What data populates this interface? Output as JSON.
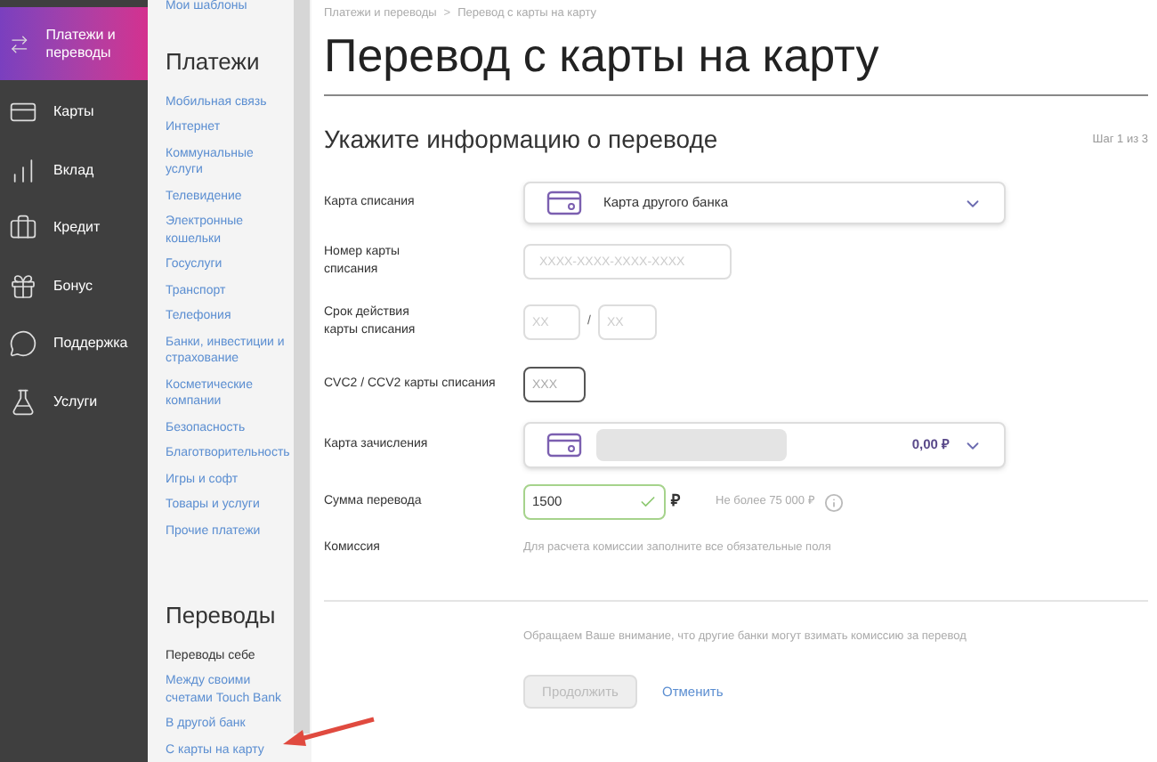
{
  "sidebar": {
    "items": [
      {
        "label": "Платежи и переводы",
        "selected": true
      },
      {
        "label": "Карты",
        "selected": false
      },
      {
        "label": "Вклад",
        "selected": false
      },
      {
        "label": "Кредит",
        "selected": false
      },
      {
        "label": "Бонус",
        "selected": false
      },
      {
        "label": "Поддержка",
        "selected": false
      },
      {
        "label": "Услуги",
        "selected": false
      }
    ]
  },
  "submenu": {
    "top_link": "Мои шаблоны",
    "sections": [
      {
        "title": "Платежи",
        "items": [
          {
            "label": "Мобильная связь",
            "kind": "link"
          },
          {
            "label": "Интернет",
            "kind": "link"
          },
          {
            "label": "Коммунальные услуги",
            "kind": "link"
          },
          {
            "label": "Телевидение",
            "kind": "link"
          },
          {
            "label": "Электронные кошельки",
            "kind": "link"
          },
          {
            "label": "Госуслуги",
            "kind": "link"
          },
          {
            "label": "Транспорт",
            "kind": "link"
          },
          {
            "label": "Телефония",
            "kind": "link"
          },
          {
            "label": "Банки, инвестиции и страхование",
            "kind": "link"
          },
          {
            "label": "Косметические компании",
            "kind": "link"
          },
          {
            "label": "Безопасность",
            "kind": "link"
          },
          {
            "label": "Благотворительность",
            "kind": "link"
          },
          {
            "label": "Игры и софт",
            "kind": "link"
          },
          {
            "label": "Товары и услуги",
            "kind": "link"
          },
          {
            "label": "Прочие платежи",
            "kind": "link"
          }
        ]
      },
      {
        "title": "Переводы",
        "items": [
          {
            "label": "Переводы себе",
            "kind": "plain"
          },
          {
            "label": "Между своими счетами Touch Bank",
            "kind": "link"
          },
          {
            "label": "В другой банк",
            "kind": "link"
          },
          {
            "label": "С карты на карту",
            "kind": "link"
          }
        ]
      }
    ]
  },
  "breadcrumbs": [
    "Платежи и переводы",
    "Перевод с карты на карту"
  ],
  "breadcrumb_separator": ">",
  "title": "Перевод с карты на карту",
  "form": {
    "title": "Укажите информацию о переводе",
    "step": "Шаг 1 из 3",
    "rows": [
      {
        "kind": "select",
        "label": "Карта списания",
        "value": "Карта другого банка"
      },
      {
        "kind": "input",
        "label": "Номер карты списания",
        "placeholder": "XXXX-XXXX-XXXX-XXXX"
      },
      {
        "kind": "expiry",
        "label": "Срок действия карты списания",
        "placeholder_month": "XX",
        "separator": "/",
        "placeholder_year": "XX"
      },
      {
        "kind": "cvc",
        "label": "CVC2 / CCV2 карты списания",
        "placeholder": "XXX",
        "focused": true
      },
      {
        "kind": "account",
        "label": "Карта зачисления",
        "balance": "0,00 ₽"
      },
      {
        "kind": "amount",
        "label": "Сумма перевода",
        "value": "1500",
        "currency": "₽",
        "valid": true,
        "hint": "Не более 75 000 ₽"
      },
      {
        "kind": "note",
        "label": "Комиссия",
        "text": "Для расчета комиссии заполните все обязательные поля"
      }
    ],
    "notice": "Обращаем Ваше внимание, что другие банки могут взимать комиссию за перевод",
    "continue": {
      "label": "Продолжить",
      "disabled": true
    },
    "cancel": "Отменить"
  }
}
